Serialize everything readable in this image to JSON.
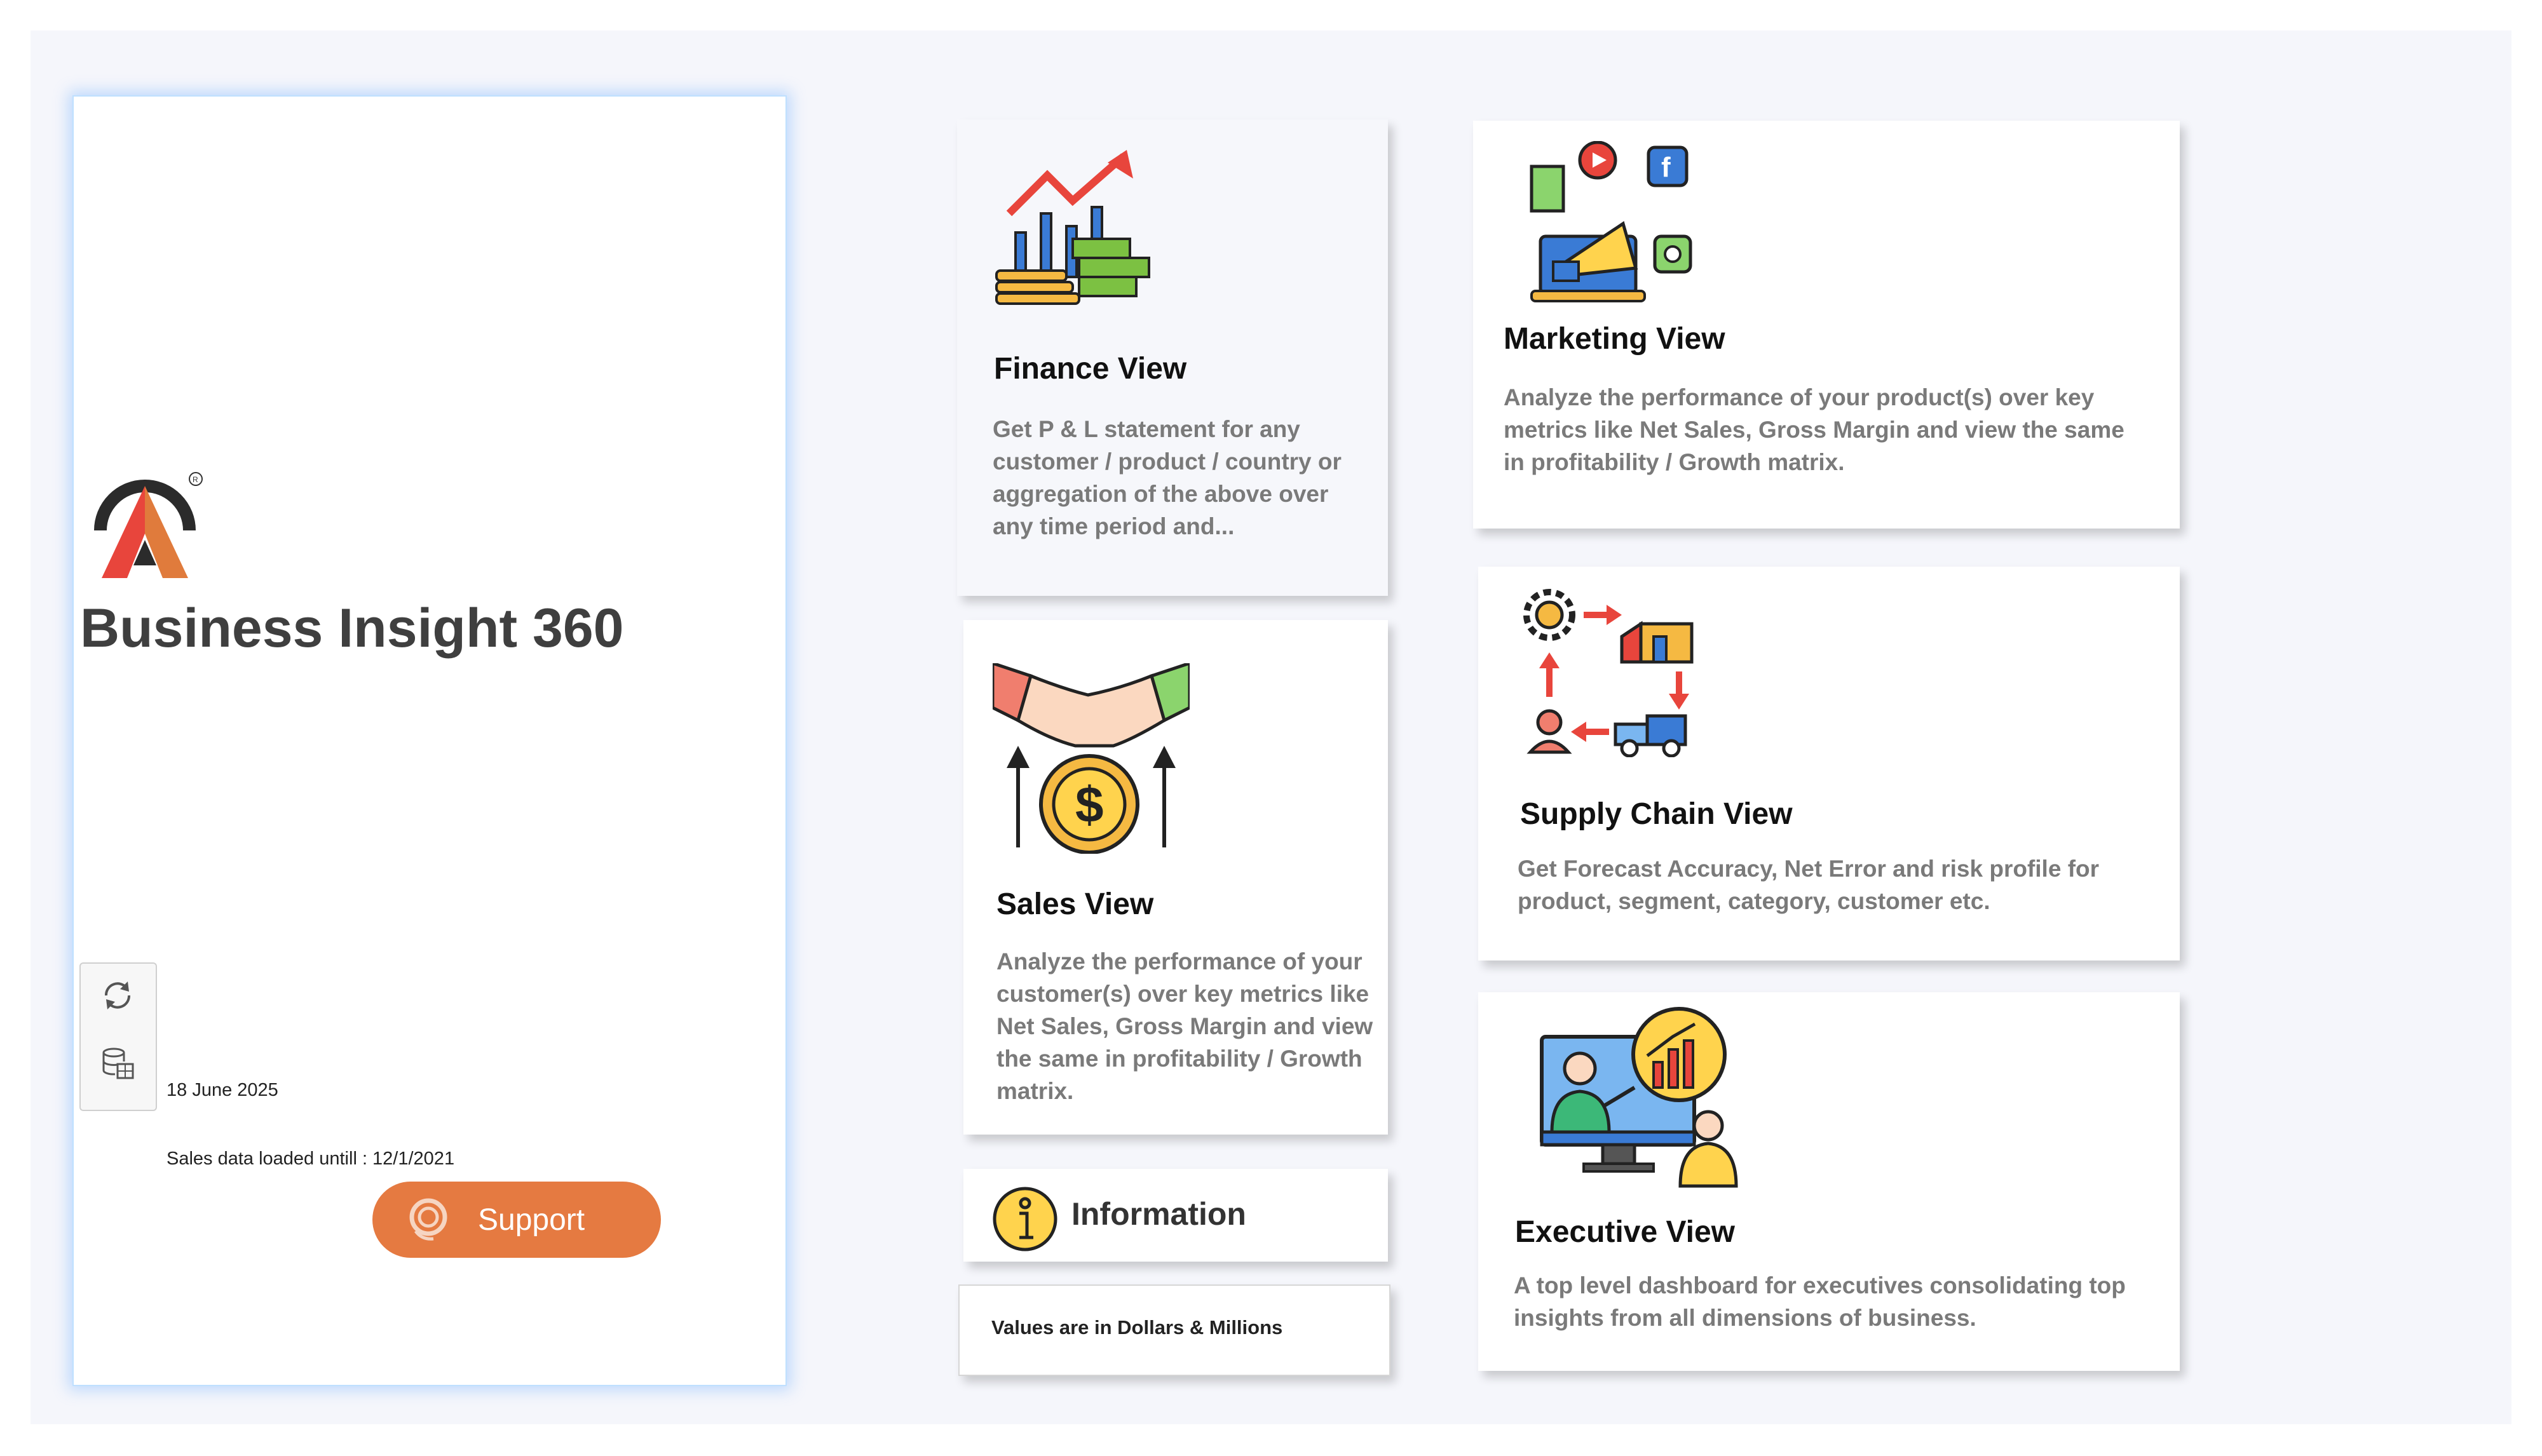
{
  "app": {
    "title": "Business Insight 360"
  },
  "status": {
    "refresh_date": "18 June 2025",
    "data_loaded": "Sales data loaded untill : 12/1/2021",
    "refresh_icon": "refresh-icon",
    "database_icon": "database-icon"
  },
  "support": {
    "label": "Support",
    "icon": "headset-icon"
  },
  "cards": {
    "finance": {
      "title": "Finance View",
      "description": "Get P & L statement for any customer / product / country or aggregation of the above over any time period and...",
      "icon": "finance-growth-icon"
    },
    "sales": {
      "title": "Sales View",
      "description": "Analyze the performance of your customer(s) over key metrics like Net Sales, Gross Margin and view the same in profitability / Growth matrix.",
      "icon": "handshake-dollar-icon"
    },
    "marketing": {
      "title": "Marketing View",
      "description": "Analyze the performance of your product(s) over key metrics like Net Sales, Gross Margin and view the same in profitability / Growth matrix.",
      "icon": "marketing-megaphone-icon"
    },
    "supply_chain": {
      "title": "Supply Chain View",
      "description": "Get Forecast Accuracy, Net Error and risk profile for product, segment, category, customer etc.",
      "icon": "supply-chain-icon"
    },
    "executive": {
      "title": "Executive View",
      "description": "A top level dashboard for executives consolidating top insights from all dimensions of business.",
      "icon": "executive-presentation-icon"
    }
  },
  "information": {
    "label": "Information",
    "icon": "info-icon"
  },
  "note": {
    "text": "Values are in Dollars & Millions"
  },
  "colors": {
    "accent": "#e57a41",
    "panel_glow": "#bfe0ff",
    "background": "#f5f6fb",
    "desc_text": "#7a7a7a"
  }
}
